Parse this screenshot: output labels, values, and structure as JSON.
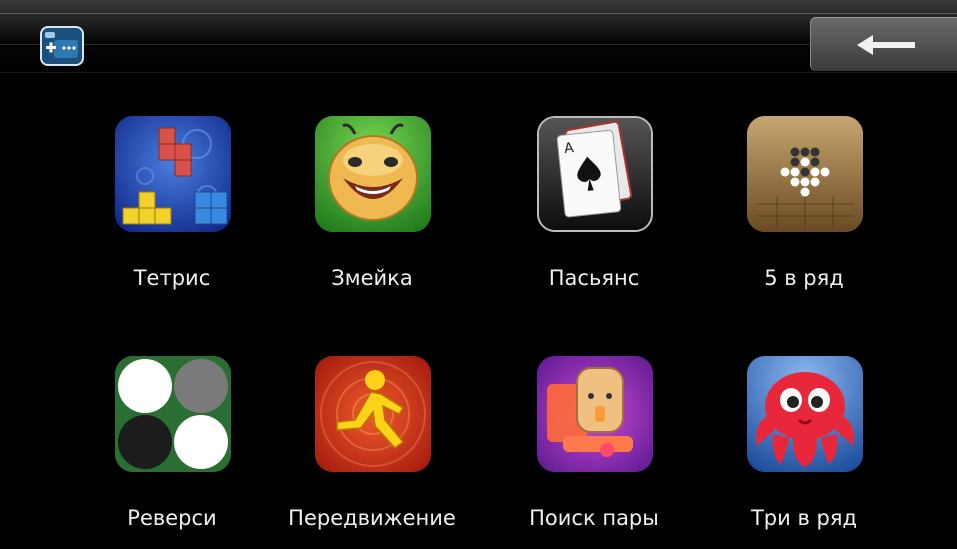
{
  "header": {
    "app_icon": "gamepad-icon",
    "back_icon": "back-arrow-icon"
  },
  "games": [
    {
      "label": "Тетрис",
      "icon": "tetris-icon"
    },
    {
      "label": "Змейка",
      "icon": "snake-icon"
    },
    {
      "label": "Пасьянс",
      "icon": "solitaire-icon"
    },
    {
      "label": "5 в ряд",
      "icon": "five-in-row-icon"
    },
    {
      "label": "Реверси",
      "icon": "reversi-icon"
    },
    {
      "label": "Передвижение",
      "icon": "move-icon"
    },
    {
      "label": "Поиск пары",
      "icon": "find-pair-icon"
    },
    {
      "label": "Три в ряд",
      "icon": "three-in-row-icon"
    }
  ],
  "colors": {
    "background": "#000000",
    "header_top": "#3a3a3a",
    "back_button": "#5a5a5a",
    "label_text": "#f0f0f0"
  }
}
